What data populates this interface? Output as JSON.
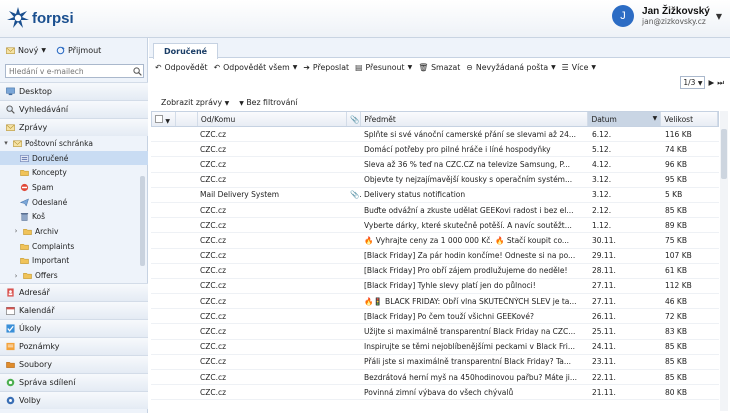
{
  "header": {
    "logo_text": "forpsi",
    "user_initial": "J",
    "user_name": "Jan Žižkovský",
    "user_email": "jan@zizkovsky.cz"
  },
  "colors": {
    "accent": "#2c6cc4",
    "selection": "#c9dcf3",
    "brand": "#1a4f8f"
  },
  "sidebar": {
    "new_label": "Nový",
    "fetch_label": "Přijmout",
    "search_placeholder": "Hledání v e-mailech",
    "sections": [
      {
        "label": "Desktop",
        "icon": "desktop-icon"
      },
      {
        "label": "Vyhledávání",
        "icon": "search-icon"
      },
      {
        "label": "Zprávy",
        "icon": "envelope-icon"
      }
    ],
    "folders": [
      {
        "label": "Poštovní schránka",
        "icon": "mailbox-icon"
      },
      {
        "label": "Doručené",
        "icon": "inbox-icon"
      },
      {
        "label": "Koncepty",
        "icon": "drafts-icon"
      },
      {
        "label": "Spam",
        "icon": "spam-icon"
      },
      {
        "label": "Odeslané",
        "icon": "sent-icon"
      },
      {
        "label": "Koš",
        "icon": "trash-icon"
      },
      {
        "label": "Archiv",
        "icon": "folder-icon"
      },
      {
        "label": "Complaints",
        "icon": "folder-icon"
      },
      {
        "label": "Important",
        "icon": "folder-icon"
      },
      {
        "label": "Offers",
        "icon": "folder-icon"
      }
    ],
    "bottom_sections": [
      {
        "label": "Adresář",
        "icon": "address-book-icon"
      },
      {
        "label": "Kalendář",
        "icon": "calendar-icon"
      },
      {
        "label": "Úkoly",
        "icon": "tasks-icon"
      },
      {
        "label": "Poznámky",
        "icon": "notes-icon"
      },
      {
        "label": "Soubory",
        "icon": "files-icon"
      },
      {
        "label": "Správa sdílení",
        "icon": "share-icon"
      },
      {
        "label": "Volby",
        "icon": "settings-icon"
      }
    ]
  },
  "main": {
    "tab_label": "Doručené",
    "toolbar": {
      "reply": "Odpovědět",
      "reply_all": "Odpovědět všem",
      "forward": "Přeposlat",
      "move": "Přesunout",
      "delete": "Smazat",
      "spam": "Nevyžádaná pošta",
      "more": "Více"
    },
    "pager": {
      "page": "1/3"
    },
    "filter": {
      "show_messages": "Zobrazit zprávy",
      "no_filter": "Bez filtrování"
    },
    "columns": {
      "from": "Od/Komu",
      "subject": "Předmět",
      "date": "Datum",
      "size": "Velikost"
    },
    "rows": [
      {
        "from": "CZC.cz",
        "subject": "Splňte si své vánoční camerské přání se slevami až 24...",
        "date": "6.12.",
        "size": "116 KB"
      },
      {
        "from": "CZC.cz",
        "subject": "Domácí potřeby pro pilné hráče i líné hospodyňky",
        "date": "5.12.",
        "size": "74 KB"
      },
      {
        "from": "CZC.cz",
        "subject": "Sleva až 36 % teď na CZC.CZ na televize Samsung, P...",
        "date": "4.12.",
        "size": "96 KB"
      },
      {
        "from": "CZC.cz",
        "subject": "Objevte ty nejzajímavější kousky s operačním systém...",
        "date": "3.12.",
        "size": "95 KB"
      },
      {
        "from": "Mail Delivery System",
        "subject": "Delivery status notification",
        "date": "3.12.",
        "size": "5 KB",
        "attachment": true
      },
      {
        "from": "CZC.cz",
        "subject": "Buďte odvážní a zkuste udělat GEEKovi radost i bez el...",
        "date": "2.12.",
        "size": "85 KB"
      },
      {
        "from": "CZC.cz",
        "subject": "Vyberte dárky, které skutečně potěší. A navíc soutěžt...",
        "date": "1.12.",
        "size": "89 KB"
      },
      {
        "from": "CZC.cz",
        "subject": "🔥 Vyhrajte ceny za 1 000 000 Kč. 🔥 Stačí koupit co...",
        "date": "30.11.",
        "size": "75 KB"
      },
      {
        "from": "CZC.cz",
        "subject": "[Black Friday] Za pár hodin končíme! Odneste si na po...",
        "date": "29.11.",
        "size": "107 KB"
      },
      {
        "from": "CZC.cz",
        "subject": "[Black Friday] Pro obří zájem prodlužujeme do neděle!",
        "date": "28.11.",
        "size": "61 KB"
      },
      {
        "from": "CZC.cz",
        "subject": "[Black Friday] Tyhle slevy platí jen do půlnoci!",
        "date": "27.11.",
        "size": "112 KB"
      },
      {
        "from": "CZC.cz",
        "subject": "🔥🚦 BLACK FRIDAY: Obří vlna SKUTEČNÝCH SLEV je ta...",
        "date": "27.11.",
        "size": "46 KB"
      },
      {
        "from": "CZC.cz",
        "subject": "[Black Friday] Po čem touží všichni GEEKové?",
        "date": "26.11.",
        "size": "72 KB"
      },
      {
        "from": "CZC.cz",
        "subject": "Užijte si maximálně transparentní Black Friday na CZC...",
        "date": "25.11.",
        "size": "83 KB"
      },
      {
        "from": "CZC.cz",
        "subject": "Inspirujte se těmi nejoblíbenějšími peckami v Black Fri...",
        "date": "24.11.",
        "size": "85 KB"
      },
      {
        "from": "CZC.cz",
        "subject": "Přáli jste si maximálně transparentní Black Friday? Ta...",
        "date": "23.11.",
        "size": "85 KB"
      },
      {
        "from": "CZC.cz",
        "subject": "Bezdrátová herní myš na 450hodinovou pařbu? Máte ji...",
        "date": "22.11.",
        "size": "85 KB"
      },
      {
        "from": "CZC.cz",
        "subject": "Povinná zimní výbava do všech chývalů",
        "date": "21.11.",
        "size": "80 KB"
      }
    ]
  }
}
